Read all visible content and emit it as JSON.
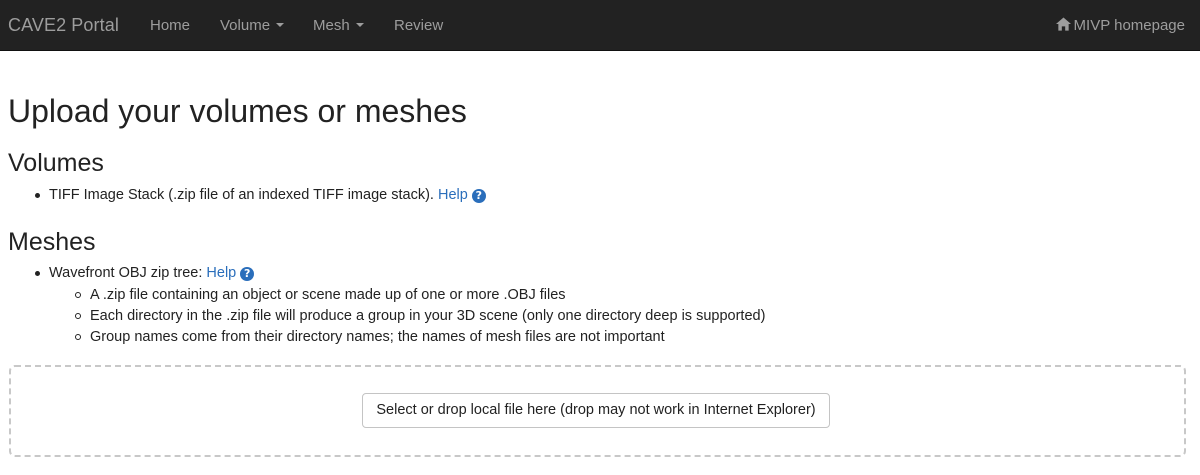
{
  "navbar": {
    "brand": "CAVE2 Portal",
    "items": [
      {
        "label": "Home"
      },
      {
        "label": "Volume"
      },
      {
        "label": "Mesh"
      },
      {
        "label": "Review"
      }
    ],
    "home_link": {
      "label": "MIVP homepage",
      "icon": "home-icon"
    }
  },
  "main": {
    "title": "Upload your volumes or meshes",
    "volumes": {
      "heading": "Volumes",
      "items": [
        {
          "text": "TIFF Image Stack (.zip file of an indexed TIFF image stack).",
          "help_label": "Help",
          "help_icon": "question-circle-icon"
        }
      ]
    },
    "meshes": {
      "heading": "Meshes",
      "items": [
        {
          "text": "Wavefront OBJ zip tree:",
          "help_label": "Help",
          "help_icon": "question-circle-icon",
          "subitems": [
            "A .zip file containing an object or scene made up of one or more .OBJ files",
            "Each directory in the .zip file will produce a group in your 3D scene (only one directory deep is supported)",
            "Group names come from their directory names; the names of mesh files are not important"
          ]
        }
      ]
    },
    "dropzone": {
      "button_label": "Select or drop local file here (drop may not work in Internet Explorer)"
    }
  },
  "colors": {
    "navbar_bg": "#222222",
    "navbar_text": "#9d9d9d",
    "link": "#2a6ebb",
    "dropzone_border": "#c8c8c8"
  }
}
